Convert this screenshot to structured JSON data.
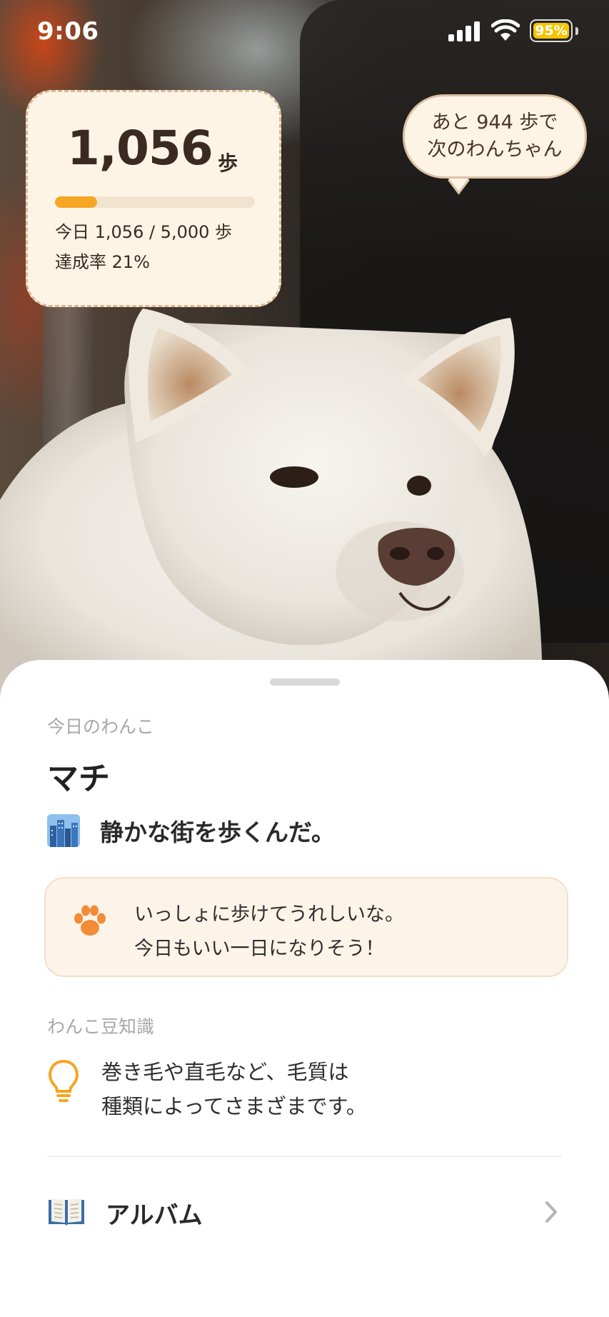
{
  "status_bar": {
    "time": "9:06",
    "battery_percent": "95%"
  },
  "steps": {
    "count": "1,056",
    "unit": "歩",
    "progress_fraction": 0.21,
    "today_line": "今日 1,056 / 5,000 歩",
    "rate_line": "達成率 21%"
  },
  "bubble": {
    "line1": "あと 944 歩で",
    "line2": "次のわんちゃん"
  },
  "sheet": {
    "today_label": "今日のわんこ",
    "dog_name": "マチ",
    "city_icon": "city-icon",
    "description": "静かな街を歩くんだ。",
    "message": {
      "icon": "paw-icon",
      "line1": "いっしょに歩けてうれしいな。",
      "line2": "今日もいい一日になりそう！"
    },
    "trivia_label": "わんこ豆知識",
    "trivia": {
      "icon": "lightbulb-icon",
      "line1": "巻き毛や直毛など、毛質は",
      "line2": "種類によってさまざまです。"
    },
    "album": {
      "icon": "book-icon",
      "label": "アルバム"
    }
  },
  "colors": {
    "accent": "#f5a623",
    "card_bg": "#fdf4e6",
    "battery": "#f5c400"
  }
}
